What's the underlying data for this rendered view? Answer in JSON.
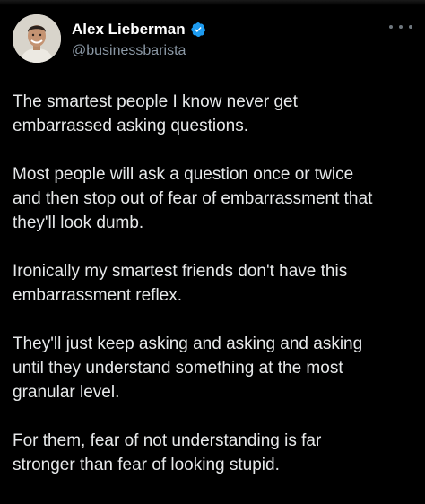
{
  "author": {
    "display_name": "Alex Lieberman",
    "handle": "@businessbarista",
    "verified": true
  },
  "tweet": {
    "paragraphs": [
      "The smartest people I know never get\nembarrassed asking questions.",
      "Most people will ask a question once or twice\nand then stop out of fear of embarrassment that\nthey'll look dumb.",
      "Ironically my smartest friends don't have this\nembarrassment reflex.",
      "They'll just keep asking and asking and asking\nuntil they understand something at the most\ngranular level.",
      "For them, fear of not understanding is far\nstronger than fear of looking stupid."
    ]
  },
  "colors": {
    "background": "#000000",
    "text": "#e7e9ea",
    "secondary_text": "#8b98a5",
    "verified_badge": "#1d9bf0"
  },
  "icons": {
    "verified": "verified-badge-icon",
    "more": "more-options-icon"
  }
}
